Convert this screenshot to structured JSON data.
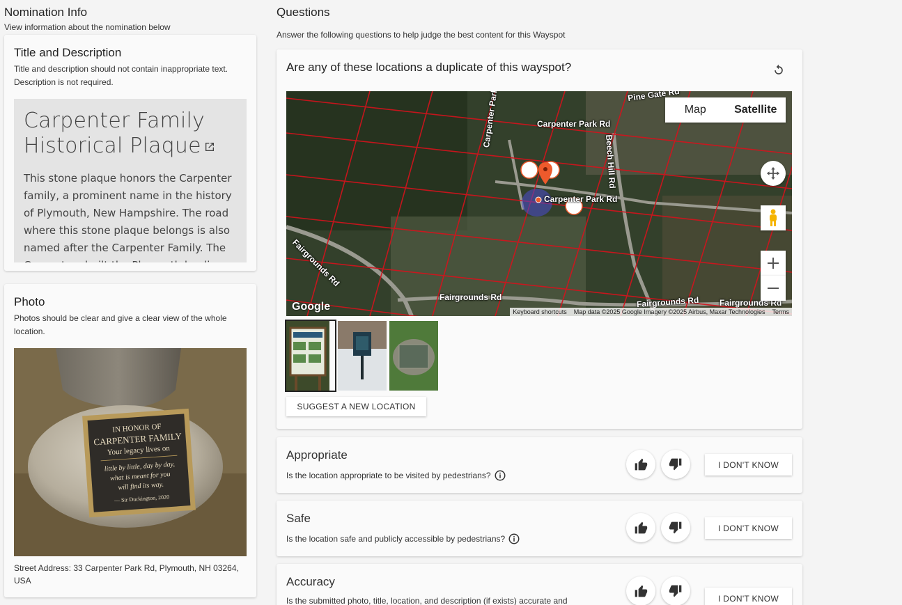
{
  "nomination": {
    "title": "Nomination Info",
    "subtitle": "View information about the nomination below"
  },
  "title_card": {
    "heading": "Title and Description",
    "hint": "Title and description should not contain inappropriate text. Description is not required.",
    "wayspot_title": "Carpenter Family Historical Plaque",
    "description": "This stone plaque honors the Carpenter family, a prominent name in the history of Plymouth, New Hampshire. The road where this stone plaque belongs is also named after the Carpenter Family. The Carpenters built the Plymouth landing"
  },
  "photo_card": {
    "heading": "Photo",
    "hint": "Photos should be clear and give a clear view of the whole location.",
    "plaque_text": [
      "IN HONOR OF",
      "CARPENTER FAMILY",
      "Your legacy lives on",
      "little by little, day by day,",
      "what is meant for you",
      "will find its way.",
      "— Sir Duckington, 2020"
    ],
    "address": "Street Address: 33 Carpenter Park Rd, Plymouth, NH 03264, USA"
  },
  "questions": {
    "title": "Questions",
    "subtitle": "Answer the following questions to help judge the best content for this Wayspot"
  },
  "duplicate": {
    "question": "Are any of these locations a duplicate of this wayspot?",
    "map": {
      "type_options": [
        "Map",
        "Satellite"
      ],
      "selected_type": "Satellite",
      "roads": [
        "Carpenter Park Rd",
        "Carpenter Park Rd",
        "Carpenter Park Rd",
        "Beech Hill Rd",
        "Fairgrounds Rd",
        "Fairgrounds Rd",
        "Fairgrounds Rd",
        "Fairgrounds Rd",
        "Pine Gate Rd"
      ],
      "logo": "Google",
      "attribution": [
        "Keyboard shortcuts",
        "Map data ©2025 Google Imagery ©2025 Airbus, Maxar Technologies",
        "Terms"
      ]
    },
    "suggest_label": "SUGGEST A NEW LOCATION"
  },
  "criteria": [
    {
      "title": "Appropriate",
      "question": "Is the location appropriate to be visited by pedestrians?",
      "idk": "I DON'T KNOW"
    },
    {
      "title": "Safe",
      "question": "Is the location safe and publicly accessible by pedestrians?",
      "idk": "I DON'T KNOW"
    },
    {
      "title": "Accuracy",
      "question": "Is the submitted photo, title, location, and description (if exists) accurate and",
      "idk": "I DON'T KNOW"
    }
  ],
  "colors": {
    "page_bg": "#f4f4f4",
    "card_bg": "#fafafa",
    "grid_red": "#d6121c",
    "pin_orange": "#ee5a2c"
  }
}
